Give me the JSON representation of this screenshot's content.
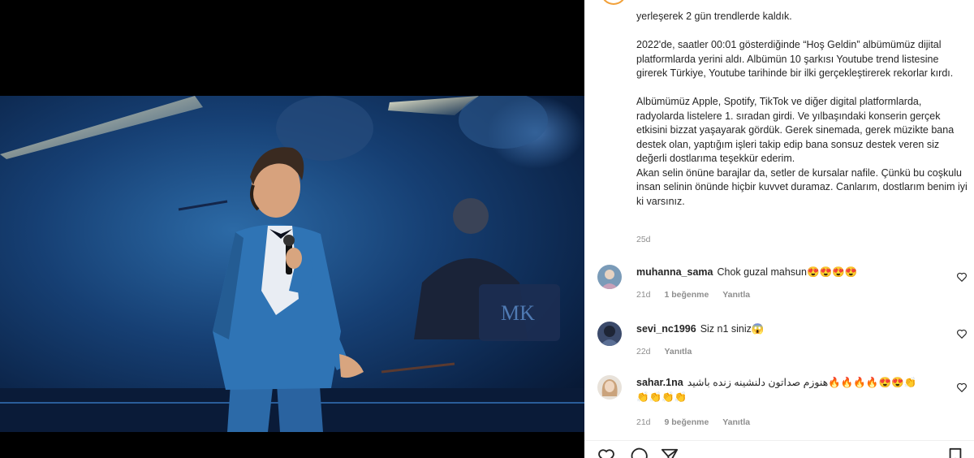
{
  "post": {
    "caption": "yerleşerek 2 gün trendlerde kaldık.\n\n2022'de, saatler 00:01 gösterdiğinde “Hoş Geldin” albümümüz dijital platformlarda yerini aldı. Albümün 10 şarkısı Youtube trend listesine girerek Türkiye, Youtube tarihinde bir ilki gerçekleştirerek rekorlar kırdı.\n\nAlbümümüz Apple, Spotify, TikTok ve diğer digital platformlarda, radyolarda listelere 1. sıradan girdi. Ve yılbaşındaki konserin gerçek etkisini bizzat yaşayarak gördük. Gerek sinemada, gerek müzikte bana destek olan, yaptığım işleri takip edip bana sonsuz destek veren siz değerli dostlarıma teşekkür ederim.\nAkan selin önüne barajlar da, setler de kursalar nafile. Çünkü bu coşkulu insan selinin önünde hiçbir kuvvet duramaz. Canlarım, dostlarım benim iyi ki varsınız.",
    "time": "25d"
  },
  "comments": [
    {
      "user": "muhanna_sama",
      "text": "Chok guzal mahsun😍😍😍😍",
      "time": "21d",
      "likes": "1 beğenme",
      "reply": "Yanıtla",
      "avatar_color": "#7a9bb8"
    },
    {
      "user": "sevi_nc1996",
      "text": "Siz n1 siniz😱",
      "time": "22d",
      "likes": "",
      "reply": "Yanıtla",
      "avatar_color": "#3b4a6b"
    },
    {
      "user": "sahar.1na",
      "text": "هنوزم صداتون دلنشینه زنده باشید🔥🔥🔥🔥😍😍👏👏👏👏👏",
      "time": "21d",
      "likes": "9 beğenme",
      "reply": "Yanıtla",
      "avatar_color": "#d9c2a8"
    }
  ],
  "photo": {
    "logo_text": "MK"
  },
  "colors": {
    "accent_ring": "#f2a13a",
    "meta_gray": "#8e8e8e",
    "text": "#262626"
  },
  "icons": [
    "heart-icon",
    "comment-icon",
    "share-icon",
    "bookmark-icon"
  ]
}
